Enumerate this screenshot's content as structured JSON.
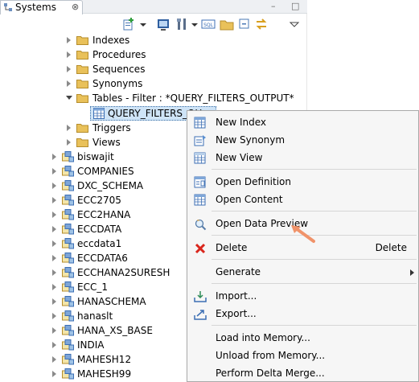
{
  "view": {
    "tab_title": "Systems",
    "tab_close": "⊗",
    "view_controls": "– □"
  },
  "tree": {
    "catalog_children": [
      "Indexes",
      "Procedures",
      "Sequences",
      "Synonyms"
    ],
    "tables_label": "Tables - Filter : *QUERY_FILTERS_OUTPUT*",
    "selected_table": "QUERY_FILTERS_OU",
    "more_children": [
      "Triggers",
      "Views"
    ],
    "schemas": [
      "biswajit",
      "COMPANIES",
      "DXC_SCHEMA",
      "ECC2705",
      "ECC2HANA",
      "ECCDATA",
      "eccdata1",
      "ECCDATA6",
      "ECCHANA2SURESH",
      "ECC_1",
      "HANASCHEMA",
      "hanaslt",
      "HANA_XS_BASE",
      "INDIA",
      "MAHESH12",
      "MAHESH99"
    ]
  },
  "context_menu": {
    "new_index": "New Index",
    "new_synonym": "New Synonym",
    "new_view": "New View",
    "open_definition": "Open Definition",
    "open_content": "Open Content",
    "open_data_preview": "Open Data Preview",
    "delete": "Delete",
    "delete_key": "Delete",
    "generate": "Generate",
    "import": "Import...",
    "export": "Export...",
    "load_into_memory": "Load into Memory...",
    "unload_from_memory": "Unload from Memory...",
    "perform_delta_merge": "Perform Delta Merge..."
  },
  "colors": {
    "folder": "#e9c15a",
    "selection": "#cfe4f7",
    "arrow": "#f0936a",
    "delete_red": "#d9261c"
  }
}
